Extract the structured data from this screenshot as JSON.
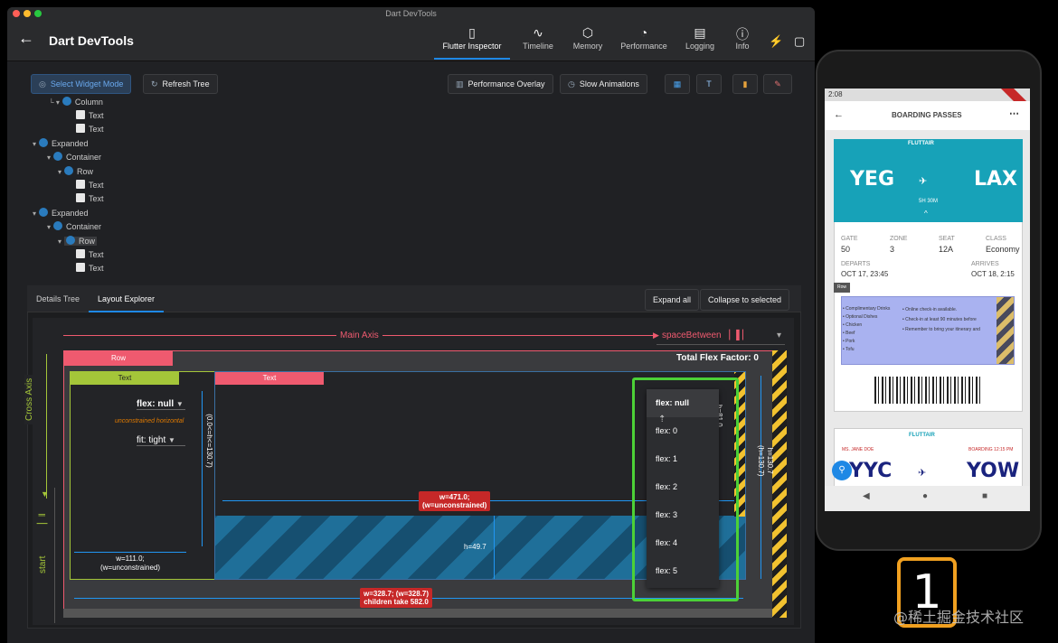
{
  "window": {
    "title": "Dart DevTools"
  },
  "appbar": {
    "title": "Dart DevTools"
  },
  "nav_tabs": [
    {
      "label": "Flutter Inspector",
      "icon": "phone-icon",
      "glyph": "▯"
    },
    {
      "label": "Timeline",
      "icon": "pulse-icon",
      "glyph": "∿"
    },
    {
      "label": "Memory",
      "icon": "cube-icon",
      "glyph": "⬡"
    },
    {
      "label": "Performance",
      "icon": "gauge-icon",
      "glyph": "◔"
    },
    {
      "label": "Logging",
      "icon": "clipboard-icon",
      "glyph": "▤"
    },
    {
      "label": "Info",
      "icon": "info-icon",
      "glyph": "ⓘ"
    }
  ],
  "toolbar": {
    "select_widget_mode": "Select Widget Mode",
    "refresh_tree": "Refresh Tree",
    "performance_overlay": "Performance Overlay",
    "slow_animations": "Slow Animations"
  },
  "tree": [
    {
      "label": "Column",
      "type": "widget"
    },
    {
      "label": "Text",
      "type": "text"
    },
    {
      "label": "Text",
      "type": "text"
    },
    {
      "label": "Expanded",
      "type": "widget"
    },
    {
      "label": "Container",
      "type": "widget"
    },
    {
      "label": "Row",
      "type": "widget"
    },
    {
      "label": "Text",
      "type": "text"
    },
    {
      "label": "Text",
      "type": "text"
    },
    {
      "label": "Expanded",
      "type": "widget"
    },
    {
      "label": "Container",
      "type": "widget"
    },
    {
      "label": "Row",
      "type": "widget",
      "selected": true
    },
    {
      "label": "Text",
      "type": "text"
    },
    {
      "label": "Text",
      "type": "text"
    }
  ],
  "detail_tabs": {
    "details_tree": "Details Tree",
    "layout_explorer": "Layout Explorer"
  },
  "detail_buttons": {
    "expand_all": "Expand all",
    "collapse_to_selected": "Collapse to selected"
  },
  "layout": {
    "main_axis": "Main Axis",
    "main_axis_alignment": "spaceBetween",
    "cross_axis": "Cross Axis",
    "cross_axis_alignment": "start",
    "row_label": "Row",
    "total_flex": "Total Flex Factor: 0",
    "child1_label": "Text",
    "child2_label": "Text",
    "flex_value": "flex: null",
    "fit_value": "fit: tight",
    "unconstrained": "unconstrained horizontal",
    "h_constraint": "h=130.7\n(0.0<=h<=130.7)",
    "w_child1": "w=111.0;\n(w=unconstrained)",
    "w_child2": "w=471.0;\n(w=unconstrained)",
    "h_child2": "h=49.7",
    "h_right": "h=81.0",
    "h_total": "h=130.7\n(h=130.7)",
    "w_total": "w=328.7; (w=328.7)\nchildren take 582.0",
    "flex_menu": [
      "flex: null",
      "flex: 0",
      "flex: 1",
      "flex: 2",
      "flex: 3",
      "flex: 4",
      "flex: 5"
    ]
  },
  "phone": {
    "time": "2:08",
    "screen_title": "BOARDING PASSES",
    "airline": "FLUTTAIR",
    "pass1": {
      "from": "YEG",
      "to": "LAX",
      "duration": "5H 30M",
      "gate_label": "GATE",
      "gate": "50",
      "zone_label": "ZONE",
      "zone": "3",
      "seat_label": "SEAT",
      "seat": "12A",
      "class_label": "CLASS",
      "class": "Economy",
      "departs_label": "DEPARTS",
      "departs": "OCT 17, 23:45",
      "arrives_label": "ARRIVES",
      "arrives": "OCT 18, 2:15",
      "row_badge": "Row",
      "treats": [
        "• Complimentary Drinks",
        "• Optional Dishes",
        "  • Chicken",
        "  • Beef",
        "  • Pork",
        "  • Tofu"
      ],
      "policy": [
        "• Online check-in available.",
        "• Check-in at least 90 minutes before",
        "• Remember to bring your itinerary and"
      ]
    },
    "pass2": {
      "from": "YYC",
      "to": "YOW",
      "passenger": "MS. JANE DOE",
      "boarding": "BOARDING 12:15 PM"
    }
  },
  "overlay_badge": "1",
  "watermark": "@稀土掘金技术社区"
}
